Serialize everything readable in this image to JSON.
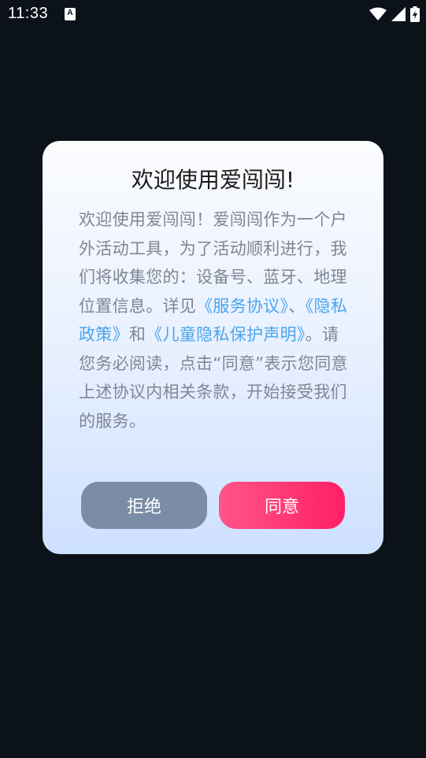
{
  "status_bar": {
    "time": "11:33",
    "notification_icon": "A",
    "icons": [
      "wifi-icon",
      "signal-icon",
      "battery-charging-icon"
    ]
  },
  "dialog": {
    "title": "欢迎使用爱闯闯!",
    "body": {
      "intro": "欢迎使用爱闯闯！爱闯闯作为一个户外活动工具，为了活动顺利进行，我们将收集您的：设备号、蓝牙、地理位置信息。详见",
      "link_service": "《服务协议》",
      "sep1": "、",
      "link_privacy": "《隐私政策》",
      "sep2": "和",
      "link_child": "《儿童隐私保护声明》",
      "outro": "。请您务必阅读，点击“同意”表示您同意上述协议内相关条款，开始接受我们的服务。"
    },
    "reject_label": "拒绝",
    "agree_label": "同意"
  },
  "colors": {
    "background": "#0c1219",
    "link": "#4aa5ee",
    "reject_button": "#7b8ca6",
    "agree_button": "#ff2f6e"
  }
}
